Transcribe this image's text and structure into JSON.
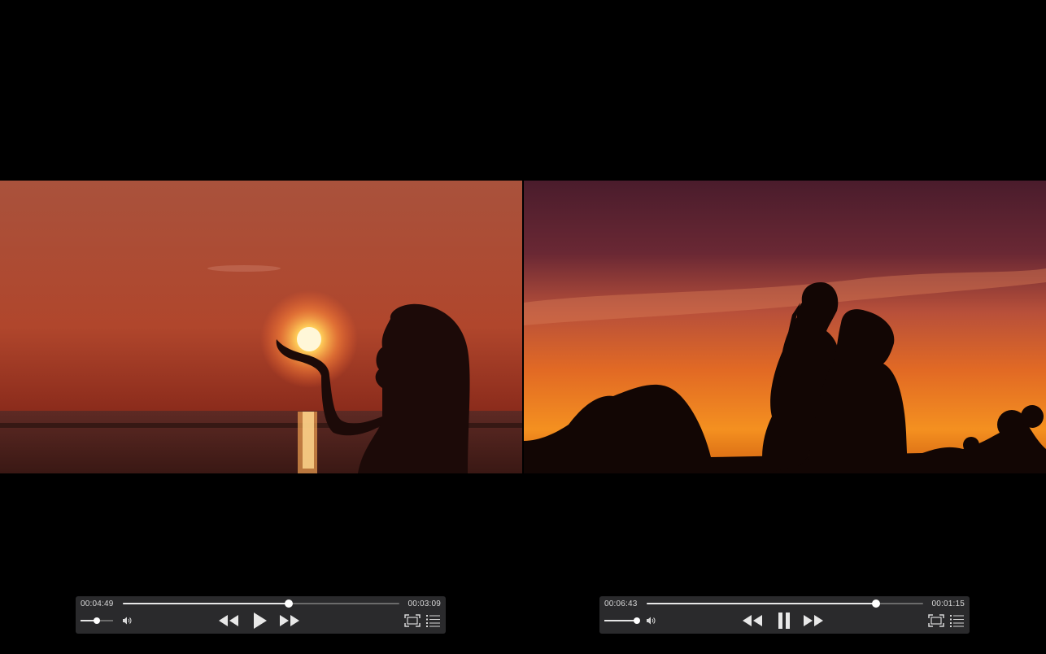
{
  "players": [
    {
      "current_time": "00:04:49",
      "remaining_time": "00:03:09",
      "progress": 0.6,
      "volume": 0.5,
      "state": "paused",
      "center_button_icon": "play-icon"
    },
    {
      "current_time": "00:06:43",
      "remaining_time": "00:01:15",
      "progress": 0.83,
      "volume": 1.0,
      "state": "playing",
      "center_button_icon": "pause-icon"
    }
  ],
  "icons": {
    "volume": "speaker-icon",
    "rewind": "rewind-icon",
    "fast_forward": "fast-forward-icon",
    "fullscreen": "fullscreen-icon",
    "playlist": "playlist-icon"
  },
  "colors": {
    "control_bg": "#2c2c2e",
    "control_text": "#d8d8d8",
    "track": "#6b6b6b",
    "track_fill": "#e6e6e6"
  }
}
